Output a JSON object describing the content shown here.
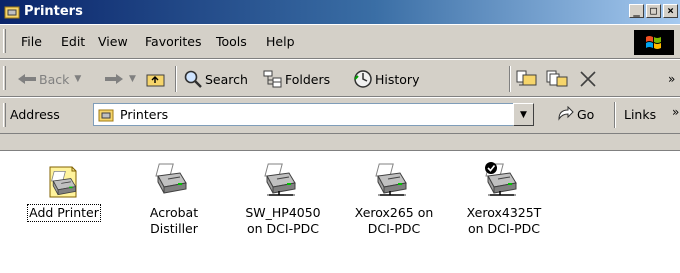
{
  "window": {
    "title": "Printers"
  },
  "menu": [
    "File",
    "Edit",
    "View",
    "Favorites",
    "Tools",
    "Help"
  ],
  "toolbar": {
    "back": "Back",
    "search": "Search",
    "folders": "Folders",
    "history": "History",
    "chevron": "»"
  },
  "address": {
    "label": "Address",
    "value": "Printers",
    "go": "Go",
    "links": "Links",
    "chevron": "»"
  },
  "items": [
    {
      "label": "Add Printer",
      "icon": "add-printer-icon"
    },
    {
      "label": "Acrobat Distiller",
      "icon": "printer-icon"
    },
    {
      "label": "SW_HP4050 on DCI-PDC",
      "icon": "network-printer-icon"
    },
    {
      "label": "Xerox265 on DCI-PDC",
      "icon": "network-printer-icon"
    },
    {
      "label": "Xerox4325T on DCI-PDC",
      "icon": "default-network-printer-icon"
    }
  ],
  "colors": {
    "titlebar_start": "#0a246a",
    "titlebar_end": "#a6caf0",
    "chrome": "#d4d0c8"
  }
}
